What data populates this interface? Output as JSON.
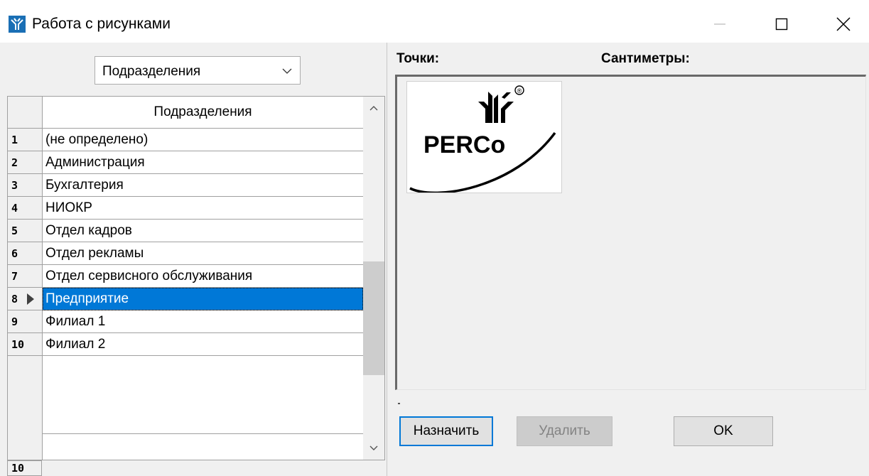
{
  "window": {
    "title": "Работа с рисунками",
    "icons": {
      "app": "perco-app-icon",
      "minimize": "minimize-icon",
      "maximize": "maximize-icon",
      "close": "close-icon"
    }
  },
  "left": {
    "combo": {
      "selected": "Подразделения",
      "icon": "chevron-down-icon"
    },
    "grid": {
      "column_header": "Подразделения",
      "rows": [
        {
          "num": "1",
          "label": "(не определено)"
        },
        {
          "num": "2",
          "label": "Администрация"
        },
        {
          "num": "3",
          "label": "Бухгалтерия"
        },
        {
          "num": "4",
          "label": "НИОКР"
        },
        {
          "num": "5",
          "label": "Отдел кадров"
        },
        {
          "num": "6",
          "label": "Отдел рекламы"
        },
        {
          "num": "7",
          "label": "Отдел сервисного обслуживания"
        },
        {
          "num": "8",
          "label": "Предприятие"
        },
        {
          "num": "9",
          "label": "Филиал 1"
        },
        {
          "num": "10",
          "label": "Филиал 2"
        }
      ],
      "selected_row": 8,
      "record_count": "10"
    }
  },
  "right": {
    "points_label": "Точки:",
    "cm_label": "Сантиметры:",
    "logo_text": "PERCo",
    "logo_mark": "®",
    "buttons": {
      "assign": "Назначить",
      "delete": "Удалить",
      "ok": "OK"
    }
  },
  "colors": {
    "selection": "#0078d7",
    "panel": "#f0f0f0",
    "logo_blue": "#1a6fb5"
  }
}
